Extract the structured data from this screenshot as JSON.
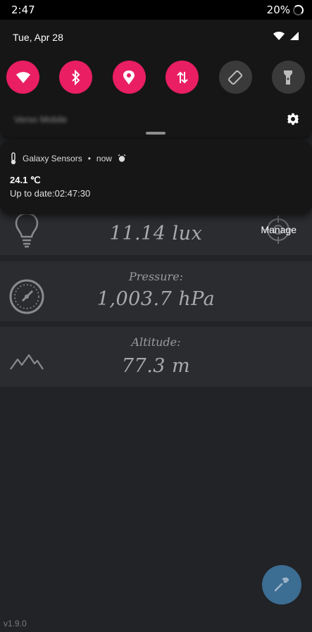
{
  "status_bar": {
    "time": "2:47",
    "battery": "20%"
  },
  "quick_settings": {
    "date": "Tue, Apr 28",
    "carrier": "Verso Mobile",
    "tiles": [
      {
        "name": "wifi-icon",
        "state": "on"
      },
      {
        "name": "bluetooth-icon",
        "state": "on"
      },
      {
        "name": "location-icon",
        "state": "on"
      },
      {
        "name": "mobile-data-icon",
        "state": "on"
      },
      {
        "name": "auto-rotate-icon",
        "state": "off"
      },
      {
        "name": "flashlight-icon",
        "state": "off"
      }
    ]
  },
  "notification": {
    "app_name": "Galaxy Sensors",
    "time": "now",
    "title": "24.1 ℃",
    "text": "Up to date:02:47:30"
  },
  "sensors": {
    "light": {
      "value": "11.14 lux",
      "manage_label": "Manage"
    },
    "pressure": {
      "label": "Pressure:",
      "value": "1,003.7 hPa"
    },
    "altitude": {
      "label": "Altitude:",
      "value": "77.3 m"
    }
  },
  "app": {
    "version": "v1.9.0"
  },
  "colors": {
    "accent": "#e91e63",
    "fab": "#3c6d93"
  }
}
